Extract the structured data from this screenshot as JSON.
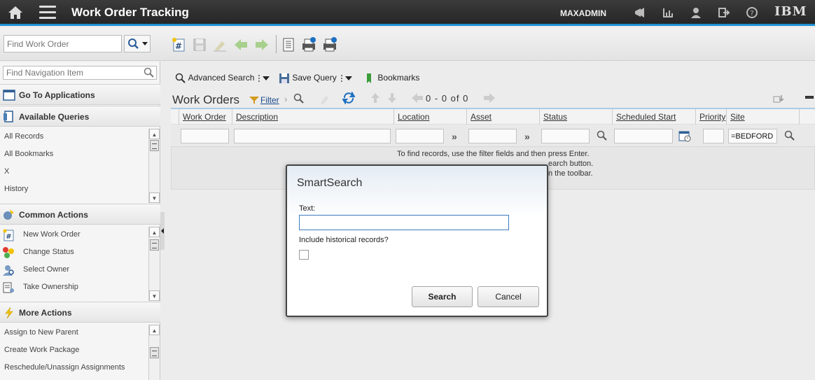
{
  "header": {
    "app_title": "Work Order Tracking",
    "user": "MAXADMIN",
    "brand": "IBM"
  },
  "toolbar": {
    "find_placeholder": "Find Work Order"
  },
  "leftnav": {
    "find_placeholder": "Find Navigation Item",
    "go_to_applications": "Go To Applications",
    "available_queries": {
      "title": "Available Queries",
      "items": [
        "All Records",
        "All Bookmarks",
        "X",
        "History"
      ]
    },
    "common_actions": {
      "title": "Common Actions",
      "items": [
        "New Work Order",
        "Change Status",
        "Select Owner",
        "Take Ownership"
      ]
    },
    "more_actions": {
      "title": "More Actions",
      "items": [
        "Assign to New Parent",
        "Create Work Package",
        "Reschedule/Unassign Assignments"
      ]
    }
  },
  "querybar": {
    "advanced_search": "Advanced Search",
    "save_query": "Save Query",
    "bookmarks": "Bookmarks"
  },
  "work_orders": {
    "title": "Work Orders",
    "filter_label": "Filter",
    "paging": "0 - 0 of 0",
    "columns": [
      "Work Order",
      "Description",
      "Location",
      "Asset",
      "Status",
      "Scheduled Start",
      "Priority",
      "Site"
    ],
    "site_filter_value": "=BEDFORD",
    "message_lines": [
      "To find records, use the filter fields and then press Enter.",
      "earch button.",
      "n the toolbar."
    ]
  },
  "dialog": {
    "title": "SmartSearch",
    "text_label": "Text:",
    "historical_label": "Include historical records?",
    "search_button": "Search",
    "cancel_button": "Cancel"
  }
}
